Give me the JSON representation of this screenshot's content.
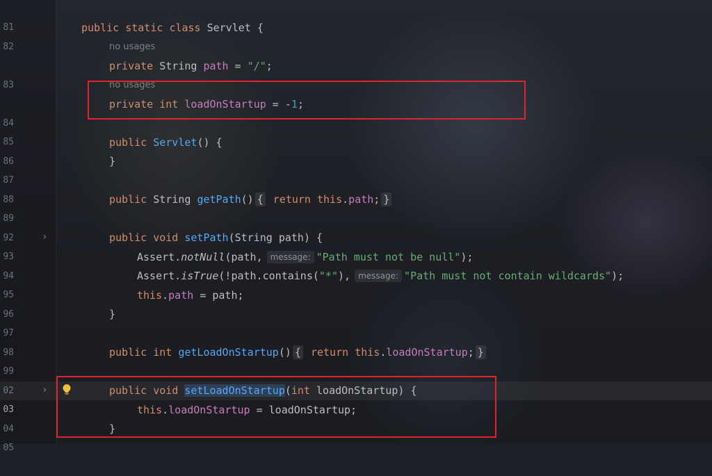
{
  "editor": {
    "hints": {
      "no_usages_1": "no usages",
      "no_usages_2": "no usages"
    },
    "inlay": {
      "message_1": "message:",
      "message_2": "message:"
    },
    "lines": [
      {
        "num": "81"
      },
      {
        "num": "82",
        "text": {
          "public": "public",
          "static": "static",
          "class": "class",
          "name": " Servlet {"
        }
      },
      {
        "num": "83",
        "text": {
          "private": "private",
          "type": " String ",
          "field": "path",
          "eq": " = ",
          "val": "\"/\"",
          "end": ";"
        }
      },
      {
        "num": "84",
        "text": {
          "private": "private",
          "int": " int ",
          "field": "loadOnStartup",
          "eq": " = ",
          "minus": "-",
          "val": "1",
          "end": ";"
        }
      },
      {
        "num": "85"
      },
      {
        "num": "86",
        "text": {
          "public": "public",
          "fn": "Servlet",
          "rest": "() {"
        }
      },
      {
        "num": "87",
        "text": {
          "rest": "}"
        }
      },
      {
        "num": "88"
      },
      {
        "num": "89",
        "text": {
          "public": "public",
          "type": " String ",
          "fn": "getPath",
          "paren": "()",
          "lb": "{",
          "ret": "return",
          "this": "this",
          "dot": ".",
          "field": "path",
          "semi": ";",
          "rb": "}"
        }
      },
      {
        "num": "92"
      },
      {
        "num": "93",
        "text": {
          "public": "public",
          "void": "void",
          "fn": "setPath",
          "rest": "(String path) {"
        }
      },
      {
        "num": "94",
        "text": {
          "cls": "Assert.",
          "m": "notNull",
          "args": "(path,",
          "str": "\"Path must not be null\"",
          "end": ");"
        }
      },
      {
        "num": "95",
        "text": {
          "cls": "Assert.",
          "m": "isTrue",
          "a1": "(!path.contains(",
          "s1": "\"*\"",
          "a2": "),",
          "str": "\"Path must not contain wildcards\"",
          "end": ");"
        }
      },
      {
        "num": "96",
        "text": {
          "this": "this",
          "dot": ".",
          "field": "path",
          "rest": " = path;"
        }
      },
      {
        "num": "97",
        "text": {
          "rest": "}"
        }
      },
      {
        "num": "98"
      },
      {
        "num": "99",
        "text": {
          "public": "public",
          "int": "int",
          "fn": "getLoadOnStartup",
          "paren": "()",
          "lb": "{",
          "ret": "return",
          "this": "this",
          "dot": ".",
          "field": "loadOnStartup",
          "semi": ";",
          "rb": "}"
        }
      },
      {
        "num": "02"
      },
      {
        "num": "03",
        "text": {
          "public": "public",
          "void": "void",
          "fn": "setLoadOnStartup",
          "p1": "(",
          "int": "int",
          "rest": " loadOnStartup) {"
        }
      },
      {
        "num": "04",
        "text": {
          "this": "this",
          "dot": ".",
          "field": "loadOnStartup",
          "rest": " = loadOnStartup;"
        }
      },
      {
        "num": "05",
        "text": {
          "rest": "}"
        }
      }
    ]
  },
  "colors": {
    "keyword": "#cf8e6d",
    "field": "#c77dbb",
    "function": "#56a8f5",
    "string": "#6aab73",
    "number": "#2aacb8",
    "highlight_box": "#e1232b"
  }
}
